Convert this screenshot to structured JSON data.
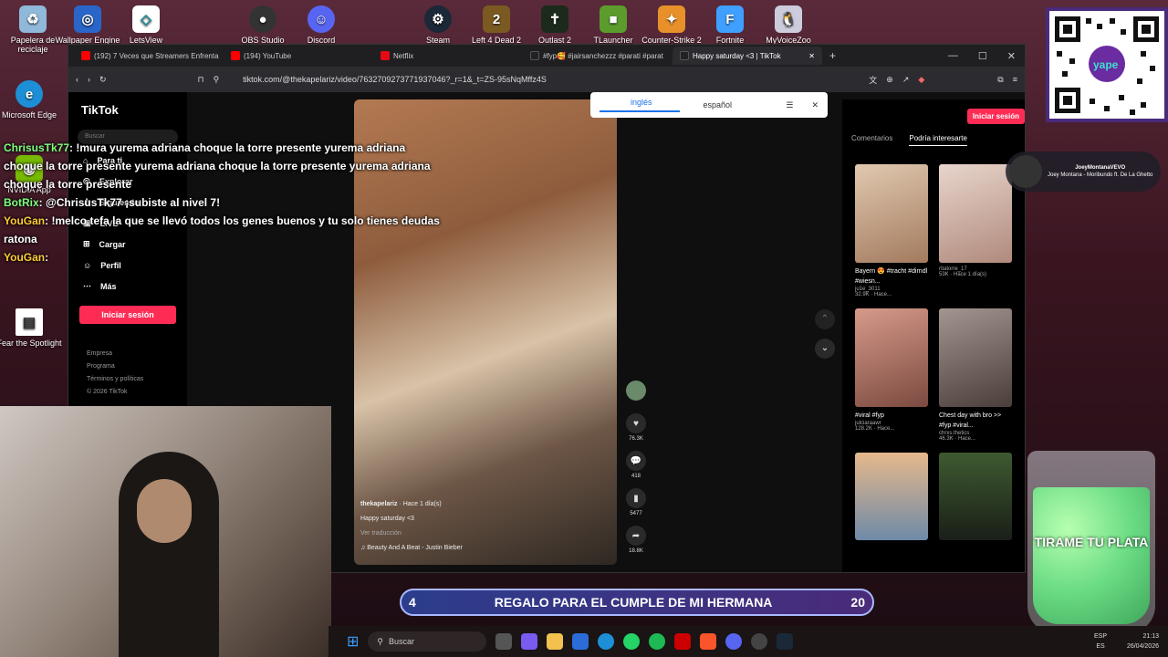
{
  "desktop": {
    "icons": [
      {
        "label": "Papelera de reciclaje",
        "icon": "recycle-bin-icon"
      },
      {
        "label": "Wallpaper Engine",
        "icon": "wallpaper-engine-icon"
      },
      {
        "label": "LetsView",
        "icon": "letsview-icon"
      },
      {
        "label": "OBS Studio",
        "icon": "obs-icon"
      },
      {
        "label": "Discord",
        "icon": "discord-icon"
      },
      {
        "label": "Steam",
        "icon": "steam-icon"
      },
      {
        "label": "Left 4 Dead 2",
        "icon": "l4d2-icon"
      },
      {
        "label": "Outlast 2",
        "icon": "outlast-icon"
      },
      {
        "label": "TLauncher",
        "icon": "tlauncher-icon"
      },
      {
        "label": "Counter-Strike 2",
        "icon": "cs2-icon"
      },
      {
        "label": "Fortnite",
        "icon": "fortnite-icon"
      },
      {
        "label": "MyVoiceZoo",
        "icon": "myvoicezoo-icon"
      },
      {
        "label": "Microsoft Edge",
        "icon": "edge-icon"
      },
      {
        "label": "NVIDIA App",
        "icon": "nvidia-icon"
      },
      {
        "label": "Fear the Spotlight",
        "icon": "file-icon"
      }
    ]
  },
  "browser": {
    "tabs": [
      {
        "title": "(192) 7 Veces que Streamers Enfrenta",
        "color": "#ff0000"
      },
      {
        "title": "(194) YouTube",
        "color": "#ff0000"
      },
      {
        "title": "Netflix",
        "color": "#e50914"
      },
      {
        "title": "#fyp🥰 #jairsanchezzz #parati #parat",
        "color": "#111111"
      },
      {
        "title": "Happy saturday <3 | TikTok",
        "color": "#111111"
      }
    ],
    "url": "tiktok.com/@thekapelariz/video/7632709273771937046?_r=1&_t=ZS-95sNqMffz4S"
  },
  "tiktok": {
    "logo": "TikTok",
    "search_placeholder": "Buscar",
    "nav": [
      {
        "label": "Para ti",
        "icon": "home-icon"
      },
      {
        "label": "Explorar",
        "icon": "compass-icon"
      },
      {
        "label": "Siguiendo",
        "icon": "following-icon"
      },
      {
        "label": "LIVE",
        "icon": "live-icon"
      },
      {
        "label": "Cargar",
        "icon": "upload-icon"
      },
      {
        "label": "Perfil",
        "icon": "user-icon"
      },
      {
        "label": "Más",
        "icon": "more-icon"
      }
    ],
    "login_button": "Iniciar sesión",
    "footer": [
      "Empresa",
      "Programa",
      "Términos y políticas",
      "© 2026 TikTok"
    ],
    "video": {
      "author": "thekapelariz",
      "time_ago": "· Hace 1 día(s)",
      "caption": "Happy saturday <3",
      "translate": "Ver traducción",
      "sound": "Beauty And A Beat - Justin Bieber",
      "likes": "76.3K",
      "comments": "418",
      "saves": "5477",
      "shares": "18.8K"
    },
    "translate_popup": {
      "source": "inglés",
      "target": "español"
    },
    "right_panel": {
      "login_button": "Iniciar sesión",
      "tab_comments": "Comentarios",
      "tab_interest": "Podría interesarte",
      "cards": [
        {
          "caption": "Bayern 😍 #tracht #dirndl #wiesn...",
          "user": "ju1e_3011",
          "stats": "32.9K · Hace...",
          "color": "#c9a58a"
        },
        {
          "caption": "ritatorre_17",
          "user": "",
          "stats": "53K · Hace 1 día(s)",
          "color": "#caa999"
        },
        {
          "caption": "#viral #fyp",
          "user": "julciaraawr",
          "stats": "128.2K · Hace...",
          "color": "#b57a6a"
        },
        {
          "caption": "Chest day with bro >> #fyp #viral...",
          "user": "chrxs.thetics",
          "stats": "46.3K · Hace...",
          "color": "#6b5a55"
        },
        {
          "caption": "",
          "user": "",
          "stats": "",
          "color": "#c2936d"
        },
        {
          "caption": "",
          "user": "",
          "stats": "",
          "color": "#2f3a2a"
        }
      ]
    },
    "music_widget": {
      "artist": "JoeyMontanaVEVO",
      "song": "Joey Montana - Moribundo ft. De La Ghetto"
    }
  },
  "stream_chat": [
    {
      "user": "ChrisusTk77",
      "text": ": !mura yurema adriana choque la torre presente yurema adriana choque la torre presente yurema adriana choque la torre presente yurema adriana choque la torre presente",
      "color": "#7fff7f"
    },
    {
      "user": "BotRix",
      "text": ": @ChrisusTk77 ¡subiste al nivel 7!",
      "color": "#7fff7f"
    },
    {
      "user": "YouGan",
      "text": ": !melco tefa la que se llevó todos los genes buenos y tu solo tienes deudas ratona",
      "color": "#ffcc33"
    },
    {
      "user": "YouGan",
      "text": ":",
      "color": "#ffcc33"
    }
  ],
  "goal_banner": {
    "left": "4",
    "text": "REGALO PARA EL CUMPLE DE MI HERMANA",
    "right": "20"
  },
  "jar_text": "TIRAME TU PLATA",
  "qr_label": "yape",
  "taskbar": {
    "search": "Buscar",
    "lang1": "ESP",
    "lang2": "ES",
    "time": "21:13",
    "date": "26/04/2026"
  }
}
